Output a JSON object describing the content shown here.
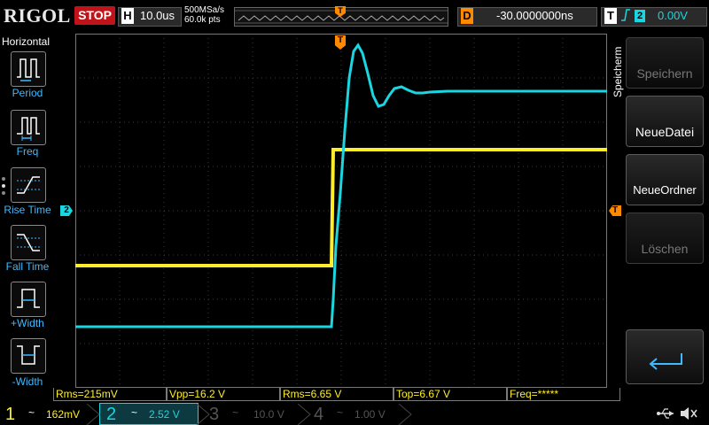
{
  "topbar": {
    "brand": "RIGOL",
    "run_state": "STOP",
    "timebase_label": "H",
    "timebase_value": "10.0us",
    "sample_rate": "500MSa/s",
    "memory_depth": "60.0k pts",
    "trigger_marker": "T",
    "delay_label": "D",
    "delay_value": "-30.0000000ns",
    "trigger_label": "T",
    "trigger_edge": "⨍",
    "trigger_source": "2",
    "trigger_level": "0.00V"
  },
  "left_menu": {
    "title": "Horizontal",
    "items": [
      {
        "label": "Period",
        "icon": "period-icon"
      },
      {
        "label": "Freq",
        "icon": "freq-icon"
      },
      {
        "label": "Rise Time",
        "icon": "rise-time-icon"
      },
      {
        "label": "Fall Time",
        "icon": "fall-time-icon"
      },
      {
        "label": "+Width",
        "icon": "positive-width-icon"
      },
      {
        "label": "-Width",
        "icon": "negative-width-icon"
      }
    ]
  },
  "right_menu": {
    "title": "Speicherm",
    "buttons": [
      {
        "label": "Speichern",
        "enabled": false
      },
      {
        "label": "NeueDatei",
        "enabled": true
      },
      {
        "label": "NeueOrdner",
        "enabled": true
      },
      {
        "label": "Löschen",
        "enabled": false
      }
    ],
    "back_icon": "return-arrow-icon"
  },
  "markers": {
    "trigger_position": "T",
    "ch2_offset": "2",
    "trigger_level_marker": "T"
  },
  "measurements": [
    {
      "text": "Rms=215mV"
    },
    {
      "text": "Vpp=16.2 V"
    },
    {
      "text": "Rms=6.65 V"
    },
    {
      "text": "Top=6.67 V"
    },
    {
      "text": "Freq=*****"
    }
  ],
  "channels": [
    {
      "num": "1",
      "coupling": "~",
      "scale": "162mV",
      "color": "#ffef2a",
      "active": true
    },
    {
      "num": "2",
      "coupling": "~",
      "scale": "2.52 V",
      "color": "#19d6e0",
      "active": true
    },
    {
      "num": "3",
      "coupling": "~",
      "scale": "10.0 V",
      "color": "#b0148c",
      "active": false
    },
    {
      "num": "4",
      "coupling": "~",
      "scale": "1.00 V",
      "color": "#2a6fd8",
      "active": false
    }
  ],
  "status_icons": [
    "usb-icon",
    "speaker-muted-icon"
  ],
  "colors": {
    "ch1": "#ffef2a",
    "ch2": "#19d6e0",
    "trigger": "#ff8a00",
    "stop": "#c0141a",
    "menu_label": "#3fb9ff"
  }
}
